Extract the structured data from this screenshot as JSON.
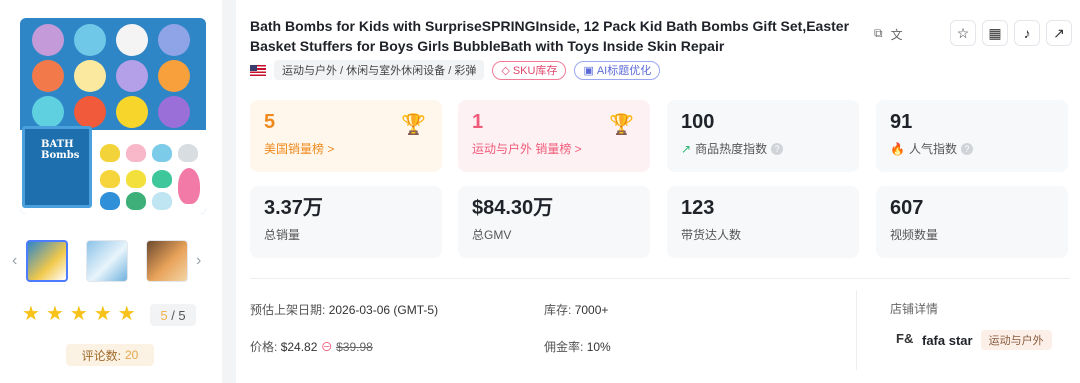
{
  "product": {
    "title": "Bath Bombs for Kids with SurpriseSPRINGInside, 12 Pack Kid Bath Bombs Gift Set,Easter Basket Stuffers for Boys Girls BubbleBath with Toys Inside Skin Repair",
    "box_text": "BATH Bombs",
    "category": "运动与户外 / 休闲与室外休闲设备 / 彩弹",
    "country_flag": "us-flag-icon",
    "badges": {
      "sku": "SKU库存",
      "ai": "AI标题优化"
    },
    "rating_value": "5",
    "rating_max": "/ 5",
    "reviews_label": "评论数:",
    "reviews_value": "20"
  },
  "metrics": [
    {
      "value": "5",
      "label": "美国销量榜 >"
    },
    {
      "value": "1",
      "label": "运动与户外 销量榜 >"
    },
    {
      "value": "100",
      "label": "商品热度指数"
    },
    {
      "value": "91",
      "label": "人气指数"
    },
    {
      "value": "3.37万",
      "label": "总销量"
    },
    {
      "value": "$84.30万",
      "label": "总GMV"
    },
    {
      "value": "123",
      "label": "带货达人数"
    },
    {
      "value": "607",
      "label": "视频数量"
    }
  ],
  "details": {
    "launch_label": "预估上架日期:",
    "launch_value": "2026-03-06 (GMT-5)",
    "stock_label": "库存:",
    "stock_value": "7000+",
    "price_label": "价格:",
    "price_value": "$24.82",
    "price_original": "$39.98",
    "commission_label": "佣金率:",
    "commission_value": "10%"
  },
  "shop": {
    "header": "店铺详情",
    "name": "fafa star",
    "category": "运动与户外"
  },
  "colors": {
    "accent_orange": "#f08a1c",
    "accent_pink": "#f05b7a",
    "star": "#f7c21a"
  }
}
